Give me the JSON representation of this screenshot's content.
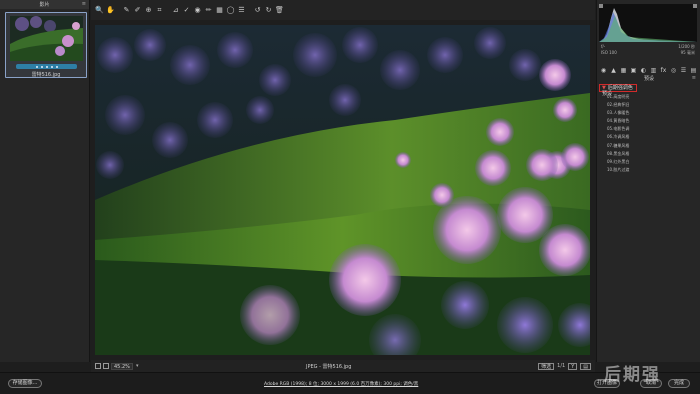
{
  "filmstrip": {
    "title": "影片",
    "menu_icon": "≡",
    "thumbnail": {
      "filename": "雷特516.jpg",
      "rating_stars": 5
    }
  },
  "toolbar": {
    "tools": [
      {
        "name": "zoom-tool-icon",
        "glyph": "🔍"
      },
      {
        "name": "hand-tool-icon",
        "glyph": "✋"
      },
      {
        "name": "white-balance-tool-icon",
        "glyph": "✎"
      },
      {
        "name": "color-sampler-tool-icon",
        "glyph": "✐"
      },
      {
        "name": "target-adjust-tool-icon",
        "glyph": "⊕"
      },
      {
        "name": "crop-tool-icon",
        "glyph": "⌗"
      },
      {
        "name": "straighten-tool-icon",
        "glyph": "⊿"
      },
      {
        "name": "spot-removal-tool-icon",
        "glyph": "✓"
      },
      {
        "name": "red-eye-tool-icon",
        "glyph": "◉"
      },
      {
        "name": "adjustment-brush-icon",
        "glyph": "✏"
      },
      {
        "name": "graduated-filter-icon",
        "glyph": "▦"
      },
      {
        "name": "radial-filter-icon",
        "glyph": "◯"
      },
      {
        "name": "preferences-icon",
        "glyph": "☰"
      },
      {
        "name": "rotate-left-icon",
        "glyph": "↺"
      },
      {
        "name": "rotate-right-icon",
        "glyph": "↻"
      },
      {
        "name": "trash-icon",
        "glyph": "🗑"
      }
    ],
    "fullscreen_glyph": "⤢"
  },
  "viewbar": {
    "zoom": "45.2%",
    "zoom_arrow": "▾",
    "file_label": "JPEG - 雷特516.jpg",
    "filter_label": "筛选",
    "page": "1/1",
    "y_label": "Y",
    "compare_icon": "▤"
  },
  "camera_info": {
    "row1_left": "f/-",
    "row1_right": "1/200 秒",
    "row2_left": "ISO 100",
    "row2_right": "95 毫米"
  },
  "right_panel": {
    "title": "预设",
    "menu_icon": "≡",
    "tab_icons": [
      "◉",
      "▲",
      "▦",
      "▣",
      "◐",
      "▥",
      "fx",
      "◎",
      "☰",
      "▤"
    ],
    "group_label": "后期强调色预设",
    "group_arrow": "▼",
    "presets": [
      "01.高度明亮",
      "02.经典怀旧",
      "03.人像暖色",
      "04.黄昏暗色",
      "05.电影色调",
      "06.冷调风格",
      "07.糖果风格",
      "08.黑金风格",
      "09.红外黑白",
      "10.胶片过渡"
    ]
  },
  "bottombar": {
    "save_label": "存储图像...",
    "info_text": "Adobe RGB (1998); 8 位; 3000 x 1999 (6.0 百万像素); 300 ppi; 调色/黑",
    "open_label": "打开图像",
    "cancel_label": "取消",
    "done_label": "完成"
  },
  "watermark": "后期强"
}
